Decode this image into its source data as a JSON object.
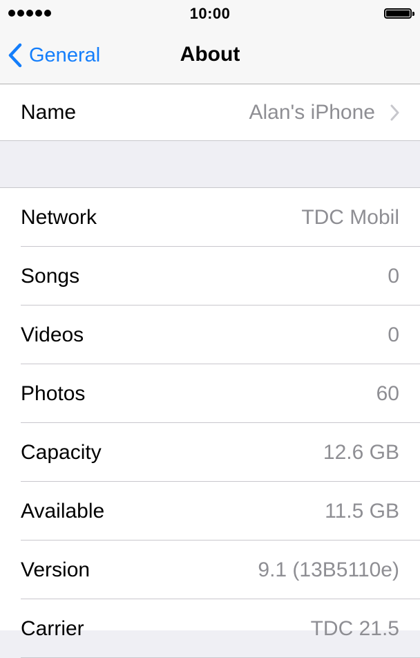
{
  "status_bar": {
    "time": "10:00",
    "signal_dots": 5,
    "battery_level": 1.0
  },
  "nav": {
    "back_label": "General",
    "title": "About"
  },
  "name_row": {
    "label": "Name",
    "value": "Alan's iPhone"
  },
  "info_rows": [
    {
      "label": "Network",
      "value": "TDC Mobil"
    },
    {
      "label": "Songs",
      "value": "0"
    },
    {
      "label": "Videos",
      "value": "0"
    },
    {
      "label": "Photos",
      "value": "60"
    },
    {
      "label": "Capacity",
      "value": "12.6 GB"
    },
    {
      "label": "Available",
      "value": "11.5 GB"
    },
    {
      "label": "Version",
      "value": "9.1 (13B5110e)"
    },
    {
      "label": "Carrier",
      "value": "TDC 21.5"
    }
  ],
  "colors": {
    "accent": "#147efb",
    "secondary_text": "#8e8e93",
    "background": "#efeff4",
    "separator": "#c8c7cc"
  }
}
